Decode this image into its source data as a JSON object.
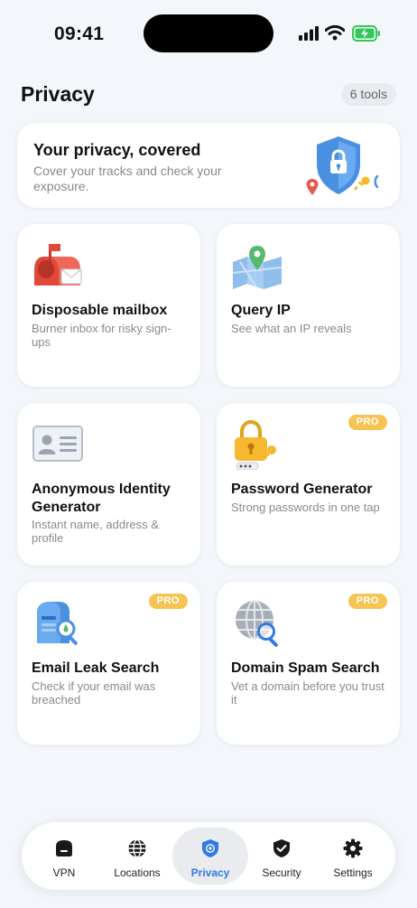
{
  "status": {
    "time": "09:41"
  },
  "header": {
    "title": "Privacy",
    "count_badge": "6 tools"
  },
  "hero": {
    "title": "Your privacy, covered",
    "subtitle": "Cover your tracks and check your exposure.",
    "icon": "shield-lock-icon"
  },
  "cards": [
    {
      "title": "Disposable mailbox",
      "description": "Burner inbox for risky sign-ups",
      "pro": "",
      "icon": "mailbox-icon"
    },
    {
      "title": "Query IP",
      "description": "See what an IP reveals",
      "pro": "",
      "icon": "map-pin-icon"
    },
    {
      "title": "Anonymous Identity Generator",
      "description": "Instant name, address & profile",
      "pro": "",
      "icon": "id-card-icon"
    },
    {
      "title": "Password Generator",
      "description": "Strong passwords in one tap",
      "pro": "PRO",
      "icon": "padlock-key-icon"
    },
    {
      "title": "Email Leak Search",
      "description": "Check if your email was breached",
      "pro": "PRO",
      "icon": "mailbox-search-icon"
    },
    {
      "title": "Domain Spam Search",
      "description": "Vet a domain before you trust it",
      "pro": "PRO",
      "icon": "globe-search-icon"
    }
  ],
  "nav": {
    "items": [
      {
        "label": "VPN",
        "icon": "vpn-icon"
      },
      {
        "label": "Locations",
        "icon": "globe-icon"
      },
      {
        "label": "Privacy",
        "icon": "privacy-shield-icon"
      },
      {
        "label": "Security",
        "icon": "security-shield-icon"
      },
      {
        "label": "Settings",
        "icon": "gear-icon"
      }
    ],
    "active": "Privacy"
  },
  "colors": {
    "accent": "#2f7be8",
    "pro_badge": "#f6c453",
    "background": "#f3f6fa"
  }
}
